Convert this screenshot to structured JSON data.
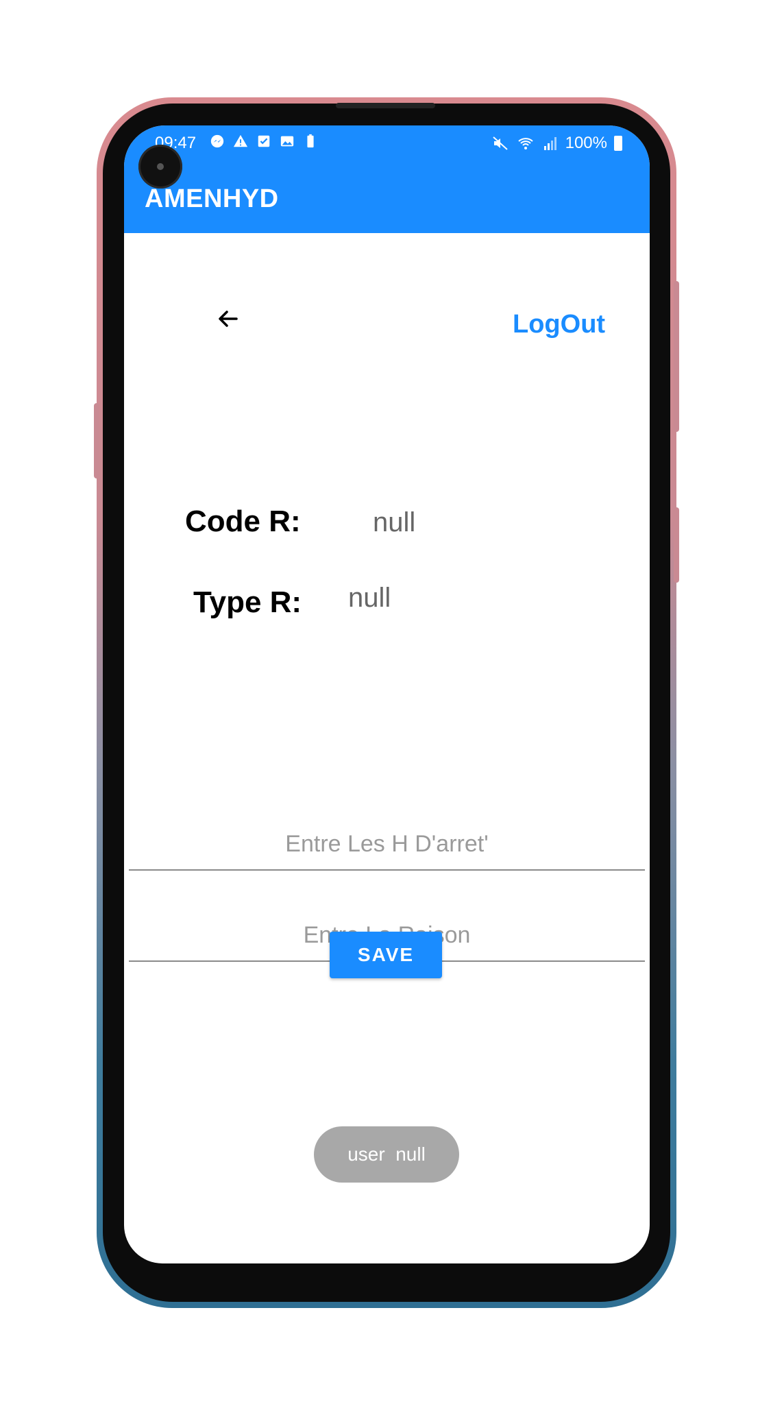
{
  "status_bar": {
    "time": "09:47",
    "battery_percent": "100%",
    "left_icons": [
      "messenger-icon",
      "warning-icon",
      "checkbox-icon",
      "image-icon",
      "battery-saver-icon"
    ],
    "right_icons": [
      "mute-icon",
      "wifi-icon",
      "signal-icon",
      "battery-icon"
    ]
  },
  "app_bar": {
    "title": "AMENHYD",
    "color": "#1a8cff"
  },
  "header": {
    "back_icon": "arrow-left-icon",
    "logout_label": "LogOut"
  },
  "details": {
    "code_label": "Code R:",
    "code_value": "null",
    "type_label": "Type R:",
    "type_value": "null"
  },
  "form": {
    "hours_placeholder": "Entre Les H D'arret'",
    "hours_value": "",
    "reason_placeholder": "Entre La Raison",
    "reason_value": "",
    "save_label": "SAVE"
  },
  "toast": {
    "text": "user  null"
  }
}
